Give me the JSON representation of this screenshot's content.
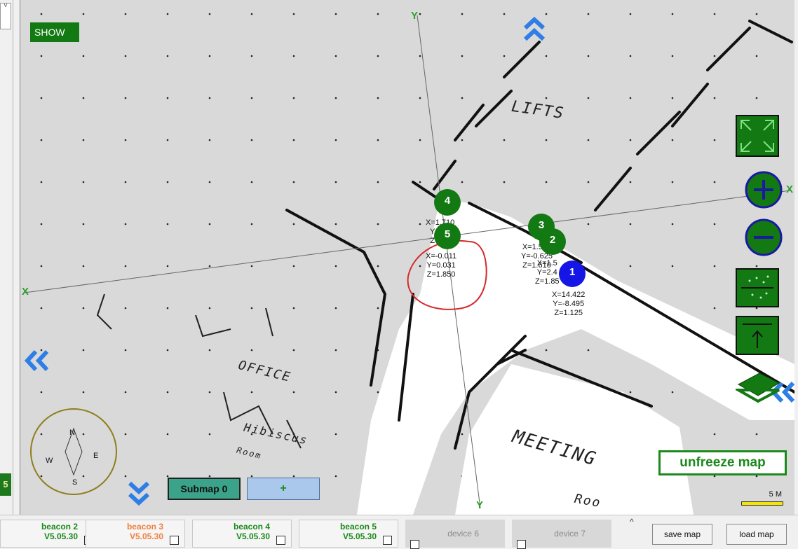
{
  "left_strip": {
    "tiny_label": "V",
    "badge": "5"
  },
  "map": {
    "show_label": "SHOW",
    "axis": {
      "x_left": "X",
      "x_right": "X",
      "y_top": "Y",
      "y_bottom": "Y"
    },
    "room_labels": {
      "lifts": "LIFTS",
      "office": "OFFICE",
      "hibiscus": "Hibiscus",
      "room": "Room",
      "meeting": "MEETING",
      "room2": "Roo"
    },
    "compass": {
      "n": "N",
      "s": "S",
      "e": "E",
      "w": "W"
    },
    "nodes": [
      {
        "id": "4",
        "color": "#137913",
        "coord": "X=1.710\nY=0.0\nZ=0.0"
      },
      {
        "id": "5",
        "color": "#137913",
        "coord": "X=-0.011\nY=0.031\nZ=1.850"
      },
      {
        "id": "3",
        "color": "#137913",
        "coord": "X=1.522\nY=-0.625\nZ=1.610"
      },
      {
        "id": "2",
        "color": "#137913",
        "coord": "X=1.5\nY=2.4\nZ=1.85"
      },
      {
        "id": "1",
        "color": "#1515e6",
        "coord": "X=14.422\nY=-8.495\nZ=1.125"
      }
    ],
    "submap_label": "Submap 0",
    "plus_label": "+",
    "unfreeze_label": "unfreeze map",
    "scale_label": "5 M",
    "annotation_color": "#d42a2a"
  },
  "devices": [
    {
      "name": "beacon 2",
      "version": "V5.05.30",
      "name_color": "#1a8a1a",
      "version_color": "#1a8a1a",
      "active": true
    },
    {
      "name": "beacon 3",
      "version": "V5.05.30",
      "name_color": "#f08040",
      "version_color": "#f08040",
      "active": true
    },
    {
      "name": "beacon 4",
      "version": "V5.05.30",
      "name_color": "#1a8a1a",
      "version_color": "#1a8a1a",
      "active": true
    },
    {
      "name": "beacon 5",
      "version": "V5.05.30",
      "name_color": "#1a8a1a",
      "version_color": "#1a8a1a",
      "active": true
    },
    {
      "name": "device 6",
      "active": false
    },
    {
      "name": "device 7",
      "active": false
    }
  ],
  "buttons": {
    "save": "save map",
    "load": "load map"
  }
}
